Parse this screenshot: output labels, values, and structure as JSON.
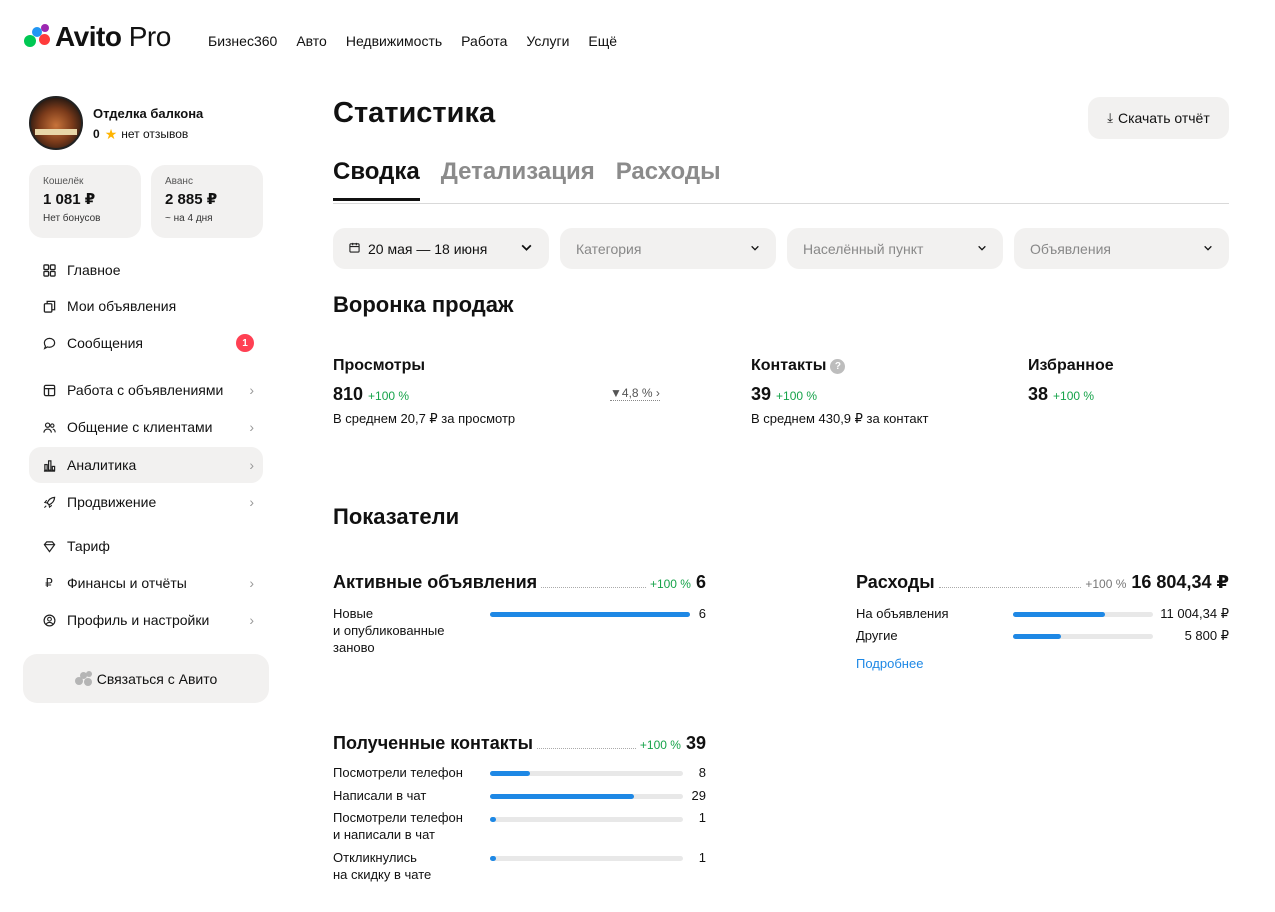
{
  "header": {
    "logo_main": "Avito",
    "logo_pro": "Pro",
    "nav": [
      "Бизнес360",
      "Авто",
      "Недвижимость",
      "Работа",
      "Услуги",
      "Ещё"
    ]
  },
  "profile": {
    "name": "Отделка балкона",
    "rating": "0",
    "reviews": "нет отзывов"
  },
  "wallet": {
    "label": "Кошелёк",
    "value": "1 081 ₽",
    "note": "Нет бонусов"
  },
  "advance": {
    "label": "Аванс",
    "value": "2 885 ₽",
    "note": "~ на 4 дня"
  },
  "sidebar": {
    "items": [
      {
        "label": "Главное",
        "icon": "grid-icon"
      },
      {
        "label": "Мои объявления",
        "icon": "copy-icon"
      },
      {
        "label": "Сообщения",
        "icon": "chat-icon",
        "badge": "1"
      },
      {
        "label": "Работа с объявлениями",
        "icon": "layout-icon"
      },
      {
        "label": "Общение с клиентами",
        "icon": "users-icon"
      },
      {
        "label": "Аналитика",
        "icon": "chart-icon",
        "active": true
      },
      {
        "label": "Продвижение",
        "icon": "rocket-icon"
      },
      {
        "label": "Тариф",
        "icon": "diamond-icon"
      },
      {
        "label": "Финансы и отчёты",
        "icon": "ruble-icon"
      },
      {
        "label": "Профиль и настройки",
        "icon": "user-circle-icon"
      }
    ],
    "contact_button": "Связаться с Авито"
  },
  "main": {
    "title": "Статистика",
    "download_button": "Скачать отчёт",
    "tabs": [
      "Сводка",
      "Детализация",
      "Расходы"
    ],
    "filters": {
      "date": "20 мая — 18 июня",
      "category": "Категория",
      "city": "Населённый пункт",
      "ads": "Объявления"
    }
  },
  "funnel": {
    "title": "Воронка продаж",
    "views": {
      "label": "Просмотры",
      "value": "810",
      "delta": "+100 %",
      "note": "В среднем 20,7 ₽ за просмотр",
      "conversion": "4,8 %"
    },
    "contacts": {
      "label": "Контакты",
      "value": "39",
      "delta": "+100 %",
      "note": "В среднем 430,9 ₽ за контакт"
    },
    "favorites": {
      "label": "Избранное",
      "value": "38",
      "delta": "+100 %"
    }
  },
  "indicators": {
    "title": "Показатели",
    "active_ads": {
      "title": "Активные объявления",
      "delta": "+100 %",
      "value": "6",
      "rows": [
        {
          "label": "Новые\nи опубликованные\nзаново",
          "value": "6",
          "fraction": 1.0
        }
      ]
    },
    "expenses": {
      "title": "Расходы",
      "delta": "+100 %",
      "value": "16 804,34 ₽",
      "rows": [
        {
          "label": "На объявления",
          "value": "11 004,34 ₽",
          "fraction": 0.655
        },
        {
          "label": "Другие",
          "value": "5 800 ₽",
          "fraction": 0.345
        }
      ],
      "more_link": "Подробнее"
    },
    "received_contacts": {
      "title": "Полученные контакты",
      "delta": "+100 %",
      "value": "39",
      "rows": [
        {
          "label": "Посмотрели телефон",
          "value": "8",
          "fraction": 0.205
        },
        {
          "label": "Написали в чат",
          "value": "29",
          "fraction": 0.744
        },
        {
          "label": "Посмотрели телефон\nи написали в чат",
          "value": "1",
          "fraction": 0.026
        },
        {
          "label": "Откликнулись\nна скидку в чате",
          "value": "1",
          "fraction": 0.026
        }
      ]
    }
  },
  "colors": {
    "accent_blue": "#1e88e5",
    "positive_green": "#16a34a",
    "badge_red": "#ff4053",
    "surface_gray": "#f2f1f0"
  }
}
